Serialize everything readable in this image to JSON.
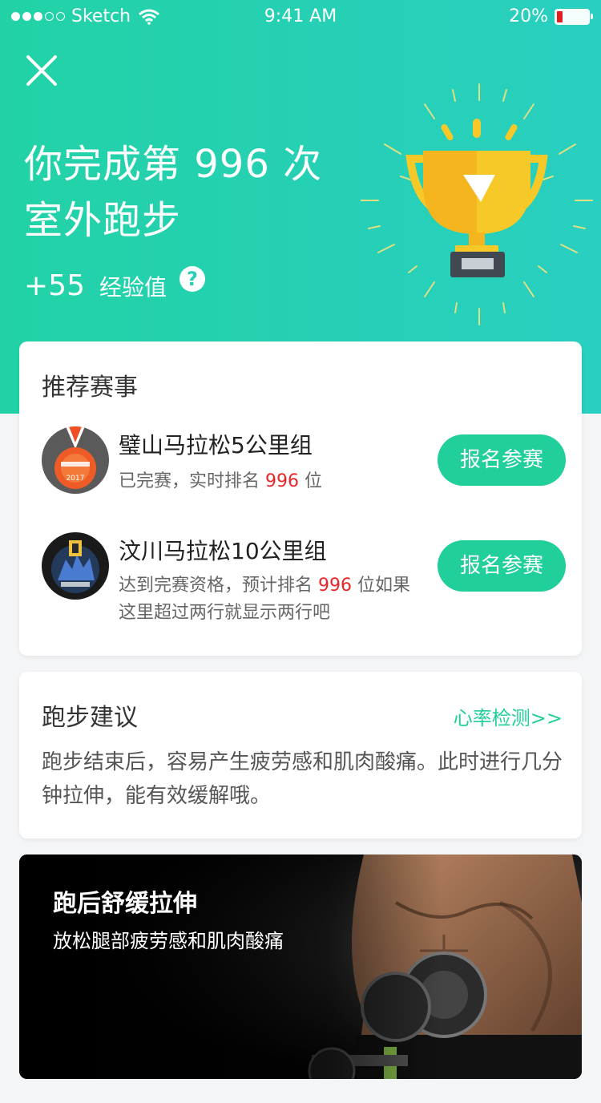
{
  "status_bar": {
    "carrier": "Sketch",
    "time": "9:41 AM",
    "battery": "20%"
  },
  "hero": {
    "title_line1": "你完成第 996 次",
    "title_line2": "室外跑步",
    "exp_value": "+55",
    "exp_label": "经验值",
    "help_glyph": "?"
  },
  "recommended": {
    "title": "推荐赛事",
    "events": [
      {
        "name": "璧山马拉松5公里组",
        "desc_prefix": "已完赛，实时排名 ",
        "rank": "996",
        "desc_suffix": " 位",
        "button": "报名参赛",
        "medal_text": "2017"
      },
      {
        "name": "汶川马拉松10公里组",
        "desc_prefix": "达到完赛资格，预计排名 ",
        "rank": "996",
        "desc_suffix": " 位如果这里超过两行就显示两行吧",
        "button": "报名参赛"
      }
    ]
  },
  "advice": {
    "title": "跑步建议",
    "link": "心率检测>>",
    "text": "跑步结束后，容易产生疲劳感和肌肉酸痛。此时进行几分钟拉伸，能有效缓解哦。"
  },
  "banner": {
    "title": "跑后舒缓拉伸",
    "subtitle": "放松腿部疲劳感和肌肉酸痛"
  },
  "colors": {
    "accent": "#20cf99",
    "hero_start": "#22d2a6",
    "hero_end": "#29cfc0",
    "rank_red": "#e8262a"
  }
}
